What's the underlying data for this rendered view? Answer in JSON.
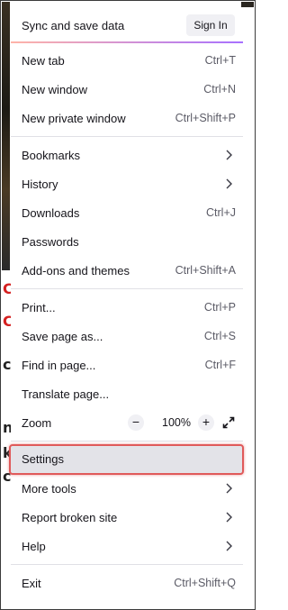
{
  "sync": {
    "label": "Sync and save data",
    "sign_in_label": "Sign In"
  },
  "menu": {
    "new_tab": {
      "label": "New tab",
      "shortcut": "Ctrl+T"
    },
    "new_window": {
      "label": "New window",
      "shortcut": "Ctrl+N"
    },
    "new_private_window": {
      "label": "New private window",
      "shortcut": "Ctrl+Shift+P"
    },
    "bookmarks": {
      "label": "Bookmarks"
    },
    "history": {
      "label": "History"
    },
    "downloads": {
      "label": "Downloads",
      "shortcut": "Ctrl+J"
    },
    "passwords": {
      "label": "Passwords"
    },
    "addons": {
      "label": "Add-ons and themes",
      "shortcut": "Ctrl+Shift+A"
    },
    "print": {
      "label": "Print...",
      "shortcut": "Ctrl+P"
    },
    "save_page": {
      "label": "Save page as...",
      "shortcut": "Ctrl+S"
    },
    "find_in_page": {
      "label": "Find in page...",
      "shortcut": "Ctrl+F"
    },
    "translate_page": {
      "label": "Translate page..."
    },
    "zoom": {
      "label": "Zoom",
      "minus": "−",
      "value": "100%",
      "plus": "+"
    },
    "settings": {
      "label": "Settings"
    },
    "more_tools": {
      "label": "More tools"
    },
    "report_broken_site": {
      "label": "Report broken site"
    },
    "help": {
      "label": "Help"
    },
    "exit": {
      "label": "Exit",
      "shortcut": "Ctrl+Shift+Q"
    }
  },
  "background_marks": [
    "C",
    "C",
    "c",
    "n",
    "k",
    "c"
  ],
  "colors": {
    "highlight_border": "#e05a5a",
    "accent_start": "#ffb4a8",
    "accent_end": "#a770ff"
  }
}
